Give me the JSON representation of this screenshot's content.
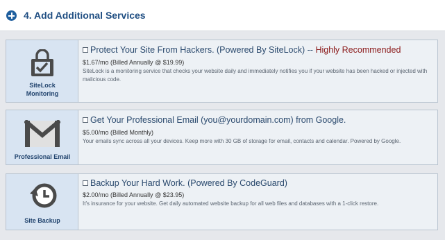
{
  "header": {
    "title": "4. Add Additional Services",
    "plus_icon": "plus-circle-icon"
  },
  "services": [
    {
      "label": "SiteLock Monitoring",
      "label_lines": [
        "SiteLock",
        "Monitoring"
      ],
      "icon": "lock-check-icon",
      "headline": "Protect Your Site From Hackers. (Powered By SiteLock) --",
      "recommended": "Highly Recommended",
      "price": "$1.67/mo (Billed Annually @ $19.99)",
      "description": "SiteLock is a monitoring service that checks your website daily and immediately notifies you if your website has been hacked or injected with malicious code.",
      "checked": false
    },
    {
      "label": "Professional Email",
      "label_lines": [
        "Professional Email"
      ],
      "icon": "gmail-envelope-icon",
      "headline": "Get Your Professional Email (you@yourdomain.com) from Google.",
      "price": "$5.00/mo (Billed Monthly)",
      "description": "Your emails sync across all your devices. Keep more with 30 GB of storage for email, contacts and calendar. Powered by Google.",
      "checked": false
    },
    {
      "label": "Site Backup",
      "label_lines": [
        "Site Backup"
      ],
      "icon": "backup-clock-icon",
      "headline": "Backup Your Hard Work. (Powered By CodeGuard)",
      "price": "$2.00/mo (Billed Annually @ $23.95)",
      "description": "It's insurance for your website. Get daily automated website backup for all web files and databases with a 1-click restore.",
      "checked": false
    }
  ],
  "colors": {
    "accent": "#1f4e82",
    "recommended": "#8b1a1a",
    "card_left_bg": "#d8e4f2",
    "card_bg": "#edf1f5"
  }
}
